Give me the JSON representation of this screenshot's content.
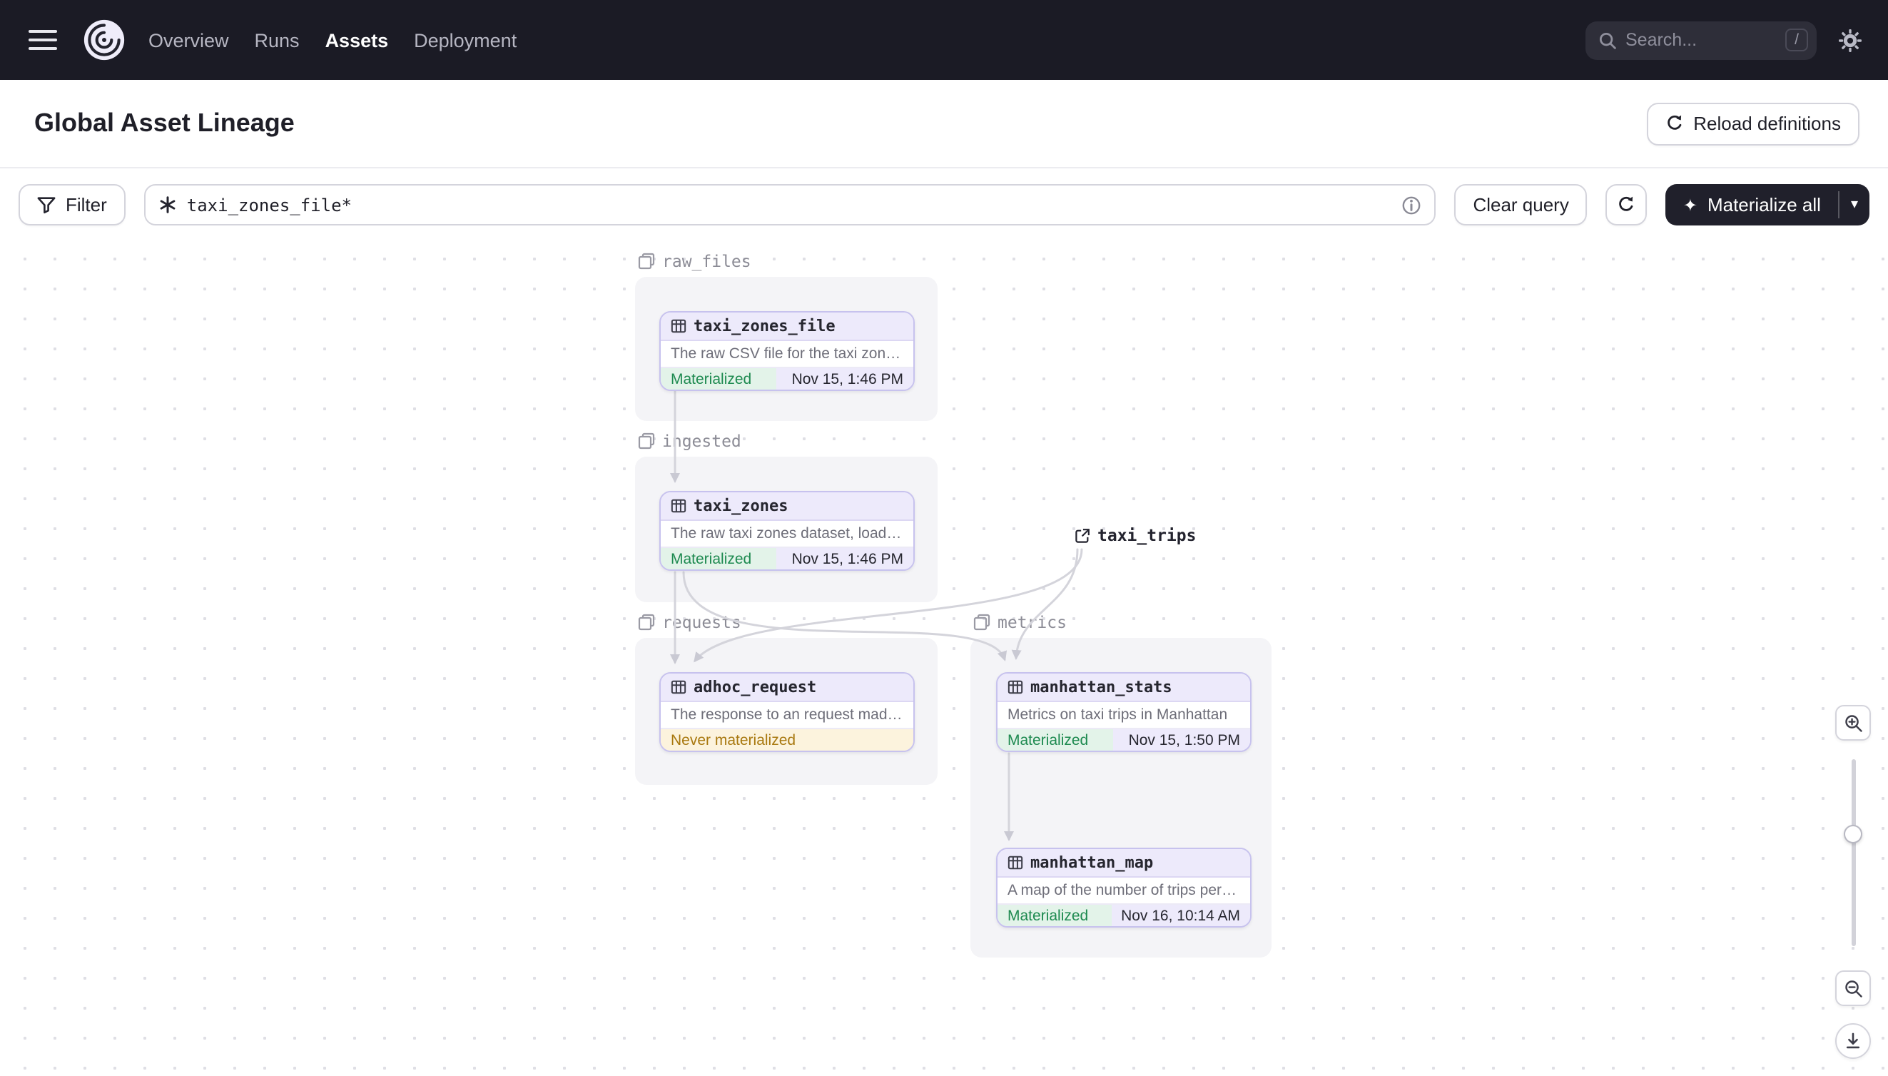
{
  "navbar": {
    "links": [
      {
        "label": "Overview"
      },
      {
        "label": "Runs"
      },
      {
        "label": "Assets"
      },
      {
        "label": "Deployment"
      }
    ],
    "search": {
      "placeholder": "Search...",
      "shortcut": "/"
    }
  },
  "header": {
    "title": "Global Asset Lineage",
    "reload_label": "Reload definitions"
  },
  "toolbar": {
    "filter_label": "Filter",
    "query_value": "taxi_zones_file*",
    "clear_label": "Clear query",
    "materialize_label": "Materialize all"
  },
  "canvas": {
    "groups": [
      {
        "name": "raw_files"
      },
      {
        "name": "ingested"
      },
      {
        "name": "requests"
      },
      {
        "name": "metrics"
      }
    ],
    "nodes": [
      {
        "name": "taxi_zones_file",
        "description": "The raw CSV file for the taxi zones dat...",
        "status": "Materialized",
        "timestamp": "Nov 15, 1:46 PM"
      },
      {
        "name": "taxi_zones",
        "description": "The raw taxi zones dataset, loaded int...",
        "status": "Materialized",
        "timestamp": "Nov 15, 1:46 PM"
      },
      {
        "name": "adhoc_request",
        "description": "The response to an request made in th...",
        "status": "Never materialized"
      },
      {
        "name": "manhattan_stats",
        "description": "Metrics on taxi trips in Manhattan",
        "status": "Materialized",
        "timestamp": "Nov 15, 1:50 PM"
      },
      {
        "name": "manhattan_map",
        "description": "A map of the number of trips per taxi z...",
        "status": "Materialized",
        "timestamp": "Nov 16, 10:14 AM"
      }
    ],
    "external_assets": [
      {
        "name": "taxi_trips"
      }
    ]
  },
  "icons": {
    "sparkle": "✦",
    "chevron_down": "▾"
  },
  "colors": {
    "navbar_bg": "#1b1b25",
    "node_header_purple": "#edeafb",
    "node_border_purple": "#c7c2ee",
    "materialized_green_text": "#1e8a50",
    "materialized_green_bg": "#e3f3e9",
    "never_materialized_text": "#a8780f",
    "never_materialized_bg": "#fcf3dd",
    "group_bg": "#f4f4f7"
  }
}
